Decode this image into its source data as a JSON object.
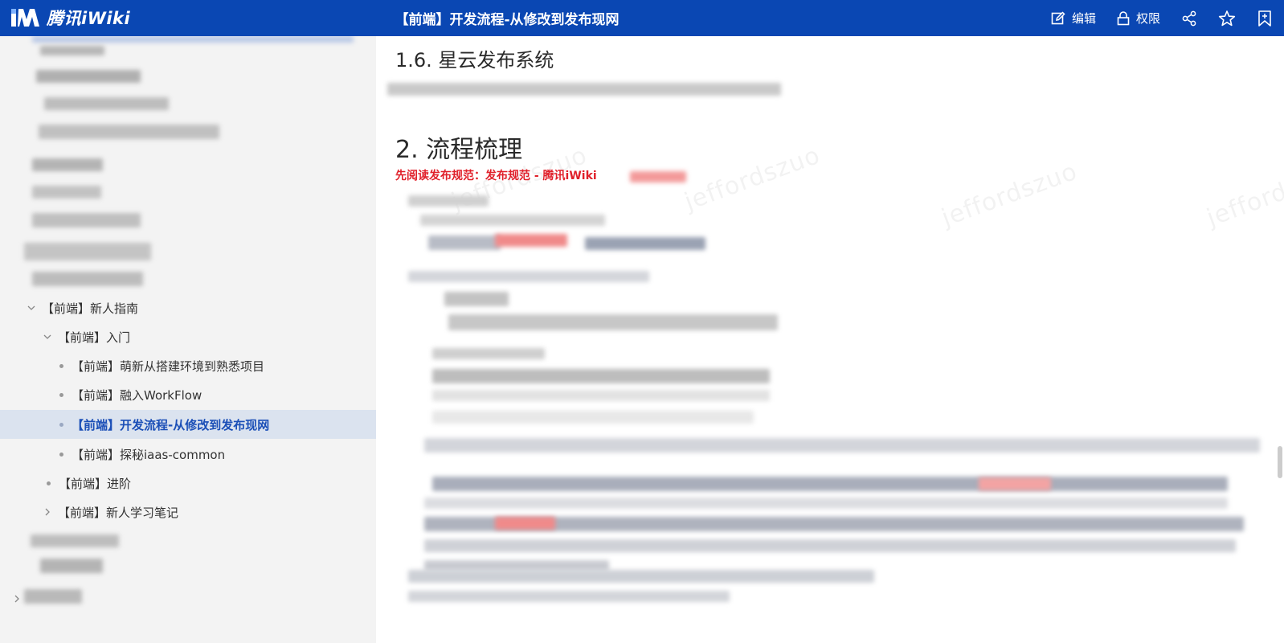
{
  "app": {
    "name": "腾讯iWiki"
  },
  "header": {
    "title": "【前端】开发流程-从修改到发布现网",
    "actions": {
      "edit": "编辑",
      "permission": "权限"
    },
    "icons": [
      "share-icon",
      "star-icon",
      "bookmark-icon"
    ]
  },
  "sidebar": {
    "items": [
      {
        "label": "【前端】新人指南",
        "state": "expanded"
      },
      {
        "label": "【前端】入门",
        "state": "expanded"
      },
      {
        "label": "【前端】萌新从搭建环境到熟悉项目",
        "state": "leaf"
      },
      {
        "label": "【前端】融入WorkFlow",
        "state": "leaf"
      },
      {
        "label": "【前端】开发流程-从修改到发布现网",
        "state": "active"
      },
      {
        "label": "【前端】探秘iaas-common",
        "state": "leaf"
      },
      {
        "label": "【前端】进阶",
        "state": "leaf"
      },
      {
        "label": "【前端】新人学习笔记",
        "state": "collapsed"
      }
    ]
  },
  "content": {
    "section_1_6": "1.6. 星云发布系统",
    "section_2": "2. 流程梳理",
    "notice": "先阅读发布规范：发布规范 - 腾讯iWiki",
    "watermark": "jeffordszuo"
  },
  "colors": {
    "brand": "#0a47b3",
    "active_bg": "#dbe3ef",
    "active_text": "#1b4fb7",
    "notice": "#e0202a"
  }
}
